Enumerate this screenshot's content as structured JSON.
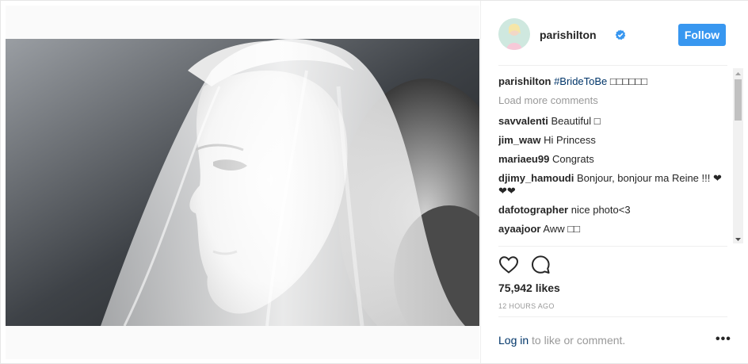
{
  "post": {
    "image_alt": "Black and white portrait of a woman wearing a bridal veil",
    "author": {
      "username": "parishilton",
      "verified": true,
      "verified_icon": "verified-badge-icon"
    },
    "follow_label": "Follow",
    "caption": {
      "user": "parishilton",
      "hashtag": "#BrideToBe",
      "emoji_text": "□□□□□□"
    },
    "load_more_label": "Load more comments",
    "comments": [
      {
        "user": "savvalenti",
        "text": "Beautiful □"
      },
      {
        "user": "jim_waw",
        "text": "Hi Princess"
      },
      {
        "user": "mariaeu99",
        "text": "Congrats"
      },
      {
        "user": "djimy_hamoudi",
        "text": "Bonjour, bonjour ma Reine !!! ❤❤❤"
      },
      {
        "user": "dafotographer",
        "text": "nice photo<3"
      },
      {
        "user": "ayaajoor",
        "text": "Aww □□"
      }
    ],
    "actions": {
      "like_icon": "heart-icon",
      "comment_icon": "comment-icon"
    },
    "likes_text": "75,942 likes",
    "timestamp": "12 HOURS AGO",
    "footer": {
      "login_link": "Log in",
      "login_rest": " to like or comment.",
      "more_label": "•••"
    }
  },
  "colors": {
    "accent": "#3897f0",
    "link": "#003569",
    "muted": "#999999",
    "text": "#262626"
  }
}
